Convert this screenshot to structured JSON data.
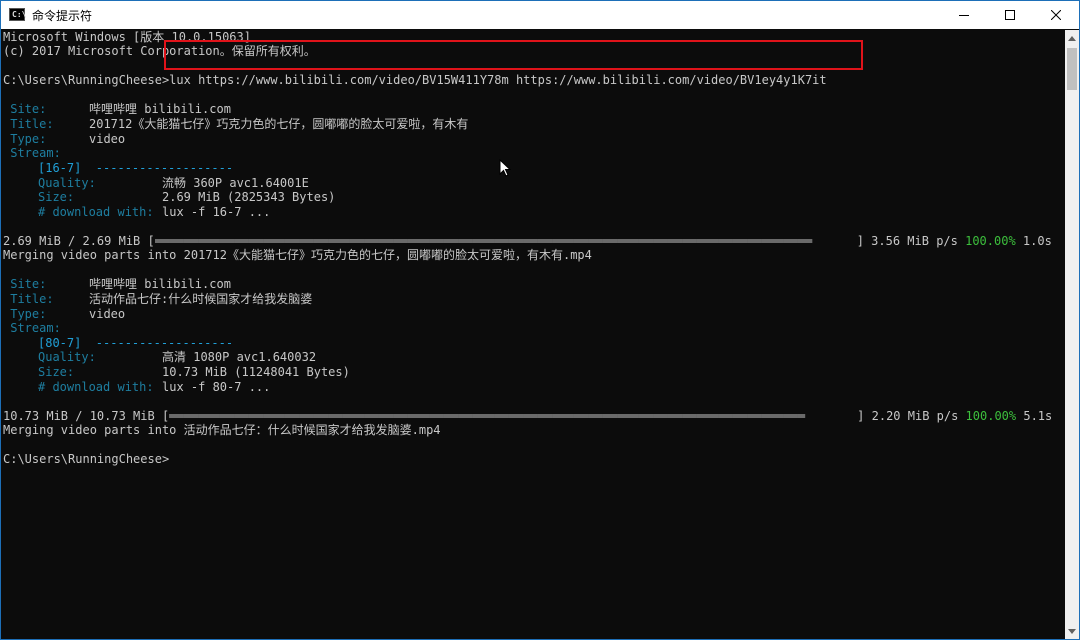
{
  "window": {
    "title": "命令提示符",
    "icon_label": "C:\\"
  },
  "header": {
    "line1": "Microsoft Windows [版本 10.0.15063]",
    "line2": "(c) 2017 Microsoft Corporation。保留所有权利。"
  },
  "command": {
    "prompt": "C:\\Users\\RunningCheese>",
    "text": "lux https://www.bilibili.com/video/BV15W411Y78m https://www.bilibili.com/video/BV1ey4y1K7it"
  },
  "labels": {
    "site": " Site:",
    "title": " Title:",
    "type": " Type:",
    "stream": " Stream:",
    "quality": "Quality:",
    "size": "Size:",
    "download_with": "# download with:"
  },
  "videos": [
    {
      "site": "哔哩哔哩 bilibili.com",
      "title": "201712《大能猫七仔》巧克力色的七仔，圆嘟嘟的脸太可爱啦，有木有",
      "type": "video",
      "stream_id": "[16-7]  -------------------",
      "quality": "流畅 360P avc1.64001E",
      "size": "2.69 MiB (2825343 Bytes)",
      "download_with": "lux -f 16-7 ...",
      "progress_size": "2.69 MiB / 2.69 MiB [",
      "progress_bar": "═══════════════════════════════════════════════════════════════════════════════════════════",
      "progress_end": "] ",
      "speed": "3.56 MiB p/s ",
      "percent": "100.00%",
      "time": " 1.0s",
      "progress_fraction": 1.0,
      "merge": "Merging video parts into 201712《大能猫七仔》巧克力色的七仔，圆嘟嘟的脸太可爱啦，有木有.mp4"
    },
    {
      "site": "哔哩哔哩 bilibili.com",
      "title": "活动作品七仔:什么时候国家才给我发脑婆",
      "type": "video",
      "stream_id": "[80-7]  -------------------",
      "quality": "高清 1080P avc1.640032",
      "size": "10.73 MiB (11248041 Bytes)",
      "download_with": "lux -f 80-7 ...",
      "progress_size": "10.73 MiB / 10.73 MiB [",
      "progress_bar": "════════════════════════════════════════════════════════════════════════════════════════",
      "progress_end": "] ",
      "speed": "2.20 MiB p/s ",
      "percent": "100.00%",
      "time": " 5.1s",
      "progress_fraction": 1.0,
      "merge": "Merging video parts into 活动作品七仔：什么时候国家才给我发脑婆.mp4"
    }
  ],
  "final_prompt": "C:\\Users\\RunningCheese>",
  "colors": {
    "background": "#0c0c0c",
    "text": "#c8c8c8",
    "label": "#1e7ea0",
    "percent": "#3cbf3c",
    "highlight_box": "#e0131a"
  }
}
